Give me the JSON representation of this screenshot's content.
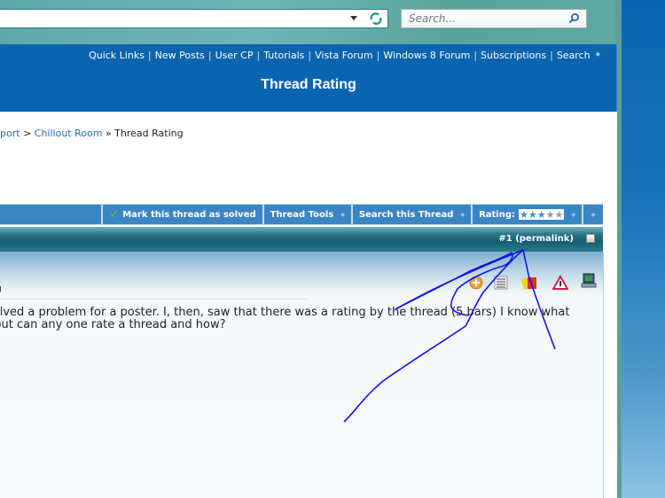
{
  "browser": {
    "address_value": "",
    "search_placeholder": "Search..."
  },
  "header": {
    "quick_links": [
      "Quick Links",
      "New Posts",
      "User CP",
      "Tutorials",
      "Vista Forum",
      "Windows 8 Forum",
      "Subscriptions",
      "Search"
    ],
    "title": "Thread Rating"
  },
  "breadcrumb": {
    "items": [
      "port",
      "Chillout Room"
    ],
    "sep1": ">",
    "sep2": "»",
    "current": "Thread Rating"
  },
  "toolbar": {
    "mark_solved": "Mark this thread as solved",
    "thread_tools": "Thread Tools",
    "search_thread": "Search this Thread",
    "rating_label": "Rating:",
    "rating_value": 3,
    "rating_max": 5
  },
  "post": {
    "permalink": "#1 (permalink)",
    "title_fragment": "ng",
    "text_line1": "solved a problem for a poster. I, then, saw that there was a rating by the thread (5 bars) I know what",
    "text_line2": ", but can any one rate a thread and how?",
    "icons": [
      "add-reputation-icon",
      "post-list-icon",
      "infraction-cards-icon",
      "report-warning-icon",
      "computer-specs-icon"
    ]
  },
  "annotation": {
    "color": "#1414e6",
    "description": "hand-drawn arrows pointing to the thread rating"
  }
}
